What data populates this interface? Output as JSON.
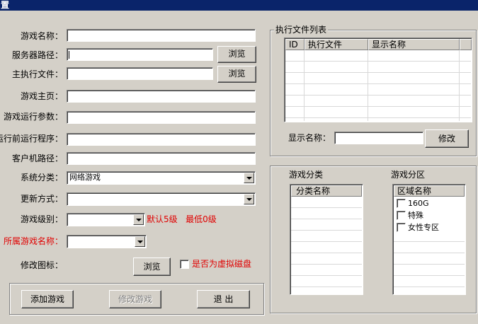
{
  "window": {
    "title": "置"
  },
  "form": {
    "game_name": {
      "label": "游戏名称：",
      "value": ""
    },
    "server_path": {
      "label": "服务器路径：",
      "value": "",
      "browse": "浏览"
    },
    "main_exe": {
      "label": "主执行文件：",
      "value": "",
      "browse": "浏览"
    },
    "homepage": {
      "label": "游戏主页：",
      "value": ""
    },
    "run_params": {
      "label": "游戏运行参数：",
      "value": ""
    },
    "pre_run": {
      "label": "运行前运行程序：",
      "value": ""
    },
    "client_path": {
      "label": "客户机路径：",
      "value": ""
    },
    "category": {
      "label": "系统分类：",
      "value": "网络游戏"
    },
    "update_mode": {
      "label": "更新方式：",
      "value": ""
    },
    "level": {
      "label": "游戏级别：",
      "value": "",
      "hint": "默认5级   最低0级"
    },
    "parent_game": {
      "label": "所属游戏名称：",
      "value": ""
    },
    "icon": {
      "label": "修改图标：",
      "browse": "浏览"
    },
    "virtual_disk": {
      "label": "是否为虚拟磁盘",
      "checked": false
    }
  },
  "buttons": {
    "add": "添加游戏",
    "modify": "修改游戏",
    "exit": "退  出"
  },
  "exe_list": {
    "title": "执行文件列表",
    "columns": [
      "ID",
      "执行文件",
      "显示名称"
    ],
    "rows": [],
    "display_name_label": "显示名称：",
    "display_name_value": "",
    "modify_button": "修改"
  },
  "categories": {
    "title": "游戏分类",
    "column": "分类名称",
    "items": []
  },
  "zones": {
    "title": "游戏分区",
    "column": "区域名称",
    "items": [
      {
        "label": "160G",
        "checked": false
      },
      {
        "label": "特殊",
        "checked": false
      },
      {
        "label": "女性专区",
        "checked": false
      }
    ]
  },
  "colors": {
    "titlebar": "#0a246a",
    "face": "#d4d0c8",
    "warning": "#e00000"
  }
}
